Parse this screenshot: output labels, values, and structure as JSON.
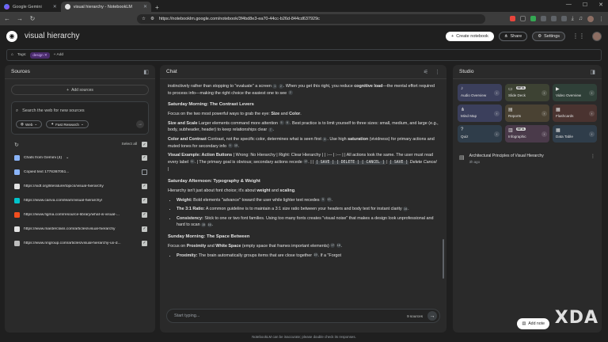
{
  "browser": {
    "tabs": [
      {
        "label": "Google Gemini",
        "active": false
      },
      {
        "label": "visual hierarchy - NotebookLM",
        "active": true
      }
    ],
    "new_tab": "+",
    "url": "https://notebooklm.google.com/notebook/3f4bd8e3-ea70-44cc-b26d-844cd637929c"
  },
  "header": {
    "title": "visual hierarchy",
    "create_label": "Create notebook",
    "share_label": "Share",
    "settings_label": "Settings"
  },
  "tags": {
    "label": "Tags:",
    "chip": "design",
    "add_label": "+ Add"
  },
  "sources": {
    "title": "Sources",
    "add_label": "Add sources",
    "search_placeholder": "Search the web for new sources",
    "web_label": "Web",
    "research_label": "Fast Research",
    "select_all": "Select all",
    "items": [
      {
        "label": "Chats from Gemini (4)",
        "checked": true,
        "icon": "gemini-icon",
        "color": "#8ab4f8"
      },
      {
        "label": "Copied text 1776367051...",
        "checked": false,
        "icon": "text-icon",
        "color": "#8ab4f8"
      },
      {
        "label": "https://ixdf.org/literature/topics/visual-hierarchy",
        "checked": true,
        "icon": "ixdf-icon",
        "color": "#e3e3e3"
      },
      {
        "label": "https://www.canva.com/learn/visual-hierarchy/",
        "checked": true,
        "icon": "canva-icon",
        "color": "#00c4cc"
      },
      {
        "label": "https://www.figma.com/resource-library/what-is-visual-...",
        "checked": true,
        "icon": "figma-icon",
        "color": "#f24e1e"
      },
      {
        "label": "https://www.masterclass.com/articles/visual-hierarchy",
        "checked": true,
        "icon": "masterclass-icon",
        "color": "#e3e3e3"
      },
      {
        "label": "https://www.nngroup.com/articles/visual-hierarchy-ux-d...",
        "checked": true,
        "icon": "nng-icon",
        "color": "#bdbdbd"
      }
    ]
  },
  "chat": {
    "title": "Chat",
    "p1": "instinctively rather than stopping to \"evaluate\" a screen",
    "p1b": ". When you get this right, you reduce",
    "p1c": "cognitive load",
    "p1d": "—the mental effort required to process info—making the right choice the easiest one to see",
    "h1": "Saturday Morning: The Contrast Levers",
    "p2a": "Focus on the two most powerful ways to grab the eye:",
    "p2b": "Size",
    "p2c": "and",
    "p2d": "Color",
    "p3a": "Size and Scale",
    "p3b": "Larger elements command more attention",
    "p3c": ". Best practice is to limit yourself to three sizes: small, medium, and large (e.g., body, subheader, header) to keep relationships clear",
    "p4a": "Color and Contrast",
    "p4b": "Contrast, not the specific color, determines what is seen first",
    "p4c": ". Use high",
    "p4d": "saturation",
    "p4e": "(vividness) for primary actions and muted tones for secondary info",
    "p5a": "Visual Example: Action Buttons",
    "p5b": "| Wrong: No Hierarchy | Right: Clear Hierarchy | | :--- | :--- | | All actions look the same. The user must read every label",
    "p5c": ". | The primary goal is obvious; secondary actions recede",
    "p5d": ". | |",
    "p5e": "[ SAVE ] [ DELETE ] [ CANCEL ]",
    "p5f": "|",
    "p5g": "[ SAVE ]",
    "p5h": "Delete",
    "p5i": "Cancel |",
    "h2": "Saturday Afternoon: Typography & Weight",
    "p6a": "Hierarchy isn't just about font choice; it's about",
    "p6b": "weight",
    "p6c": "and",
    "p6d": "scaling",
    "li1a": "Weight:",
    "li1b": "Bold elements \"advance\" toward the user while lighter text recedes",
    "li2a": "The 3:1 Ratio:",
    "li2b": "A common guideline is to maintain a 3:1 size ratio between your headers and body text for instant clarity",
    "li3a": "Consistency:",
    "li3b": "Stick to one or two font families. Using too many fonts creates \"visual noise\" that makes a design look unprofessional and hard to scan",
    "h3": "Sunday Morning: The Space Between",
    "p7a": "Focus on",
    "p7b": "Proximity",
    "p7c": "and",
    "p7d": "White Space",
    "p7e": "(empty space that frames important elements)",
    "li4a": "Proximity:",
    "li4b": "The brain automatically groups items that are close together",
    "li4c": ". If a \"Forgot",
    "cites": [
      "1",
      "2",
      "3",
      "5",
      "6",
      "7",
      "8",
      "9",
      "10",
      "11",
      "12",
      "5",
      "13",
      "14",
      "15",
      "16",
      "17",
      "18",
      "19"
    ],
    "input_placeholder": "Start typing...",
    "source_count": "9 sources"
  },
  "studio": {
    "title": "Studio",
    "tiles": [
      {
        "label": "Audio Overview",
        "icon": "audio-icon",
        "color": "#3b3f5c",
        "beta": ""
      },
      {
        "label": "Slide Deck",
        "icon": "slides-icon",
        "color": "#3d4233",
        "beta": "BETA"
      },
      {
        "label": "Video Overview",
        "icon": "video-icon",
        "color": "#2f4038",
        "beta": ""
      },
      {
        "label": "Mind Map",
        "icon": "mindmap-icon",
        "color": "#3b3f5c",
        "beta": ""
      },
      {
        "label": "Reports",
        "icon": "reports-icon",
        "color": "#4a4233",
        "beta": ""
      },
      {
        "label": "Flashcards",
        "icon": "flashcards-icon",
        "color": "#4a3330",
        "beta": ""
      },
      {
        "label": "Quiz",
        "icon": "quiz-icon",
        "color": "#2f3d4a",
        "beta": ""
      },
      {
        "label": "Infographic",
        "icon": "infographic-icon",
        "color": "#4a3a4a",
        "beta": "BETA"
      },
      {
        "label": "Data Table",
        "icon": "table-icon",
        "color": "#2f3d4a",
        "beta": ""
      }
    ],
    "note": {
      "title": "Architectural Principles of Visual Hierarchy",
      "time": "3h ago"
    },
    "add_note_label": "Add note"
  },
  "footer": "NotebookLM can be inaccurate; please double check its responses.",
  "watermark": "XDA"
}
